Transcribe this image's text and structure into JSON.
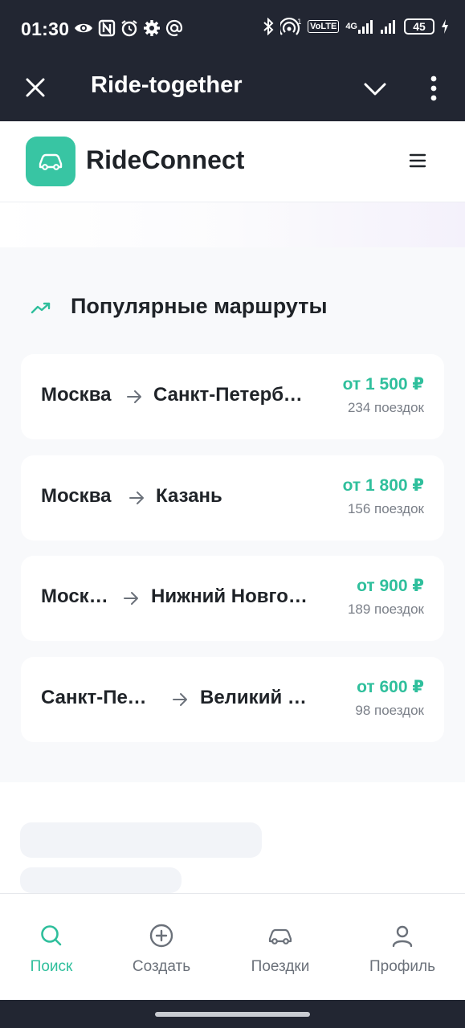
{
  "status_bar": {
    "time": "01:30",
    "volte": "VoLTE",
    "network": "4G",
    "battery": "45",
    "icons": [
      "eye-icon",
      "nfc-icon",
      "alarm-icon",
      "settings-icon",
      "at-icon",
      "bluetooth-icon",
      "hotspot-icon",
      "signal-icon",
      "battery-icon",
      "charging-icon"
    ]
  },
  "app_bar": {
    "title": "Ride-together",
    "icons": [
      "close-icon",
      "chevron-down-icon",
      "more-vert-icon"
    ]
  },
  "header": {
    "brand": "RideConnect",
    "icons": [
      "car-icon",
      "menu-icon"
    ],
    "accent": "#38c5a3"
  },
  "popular": {
    "title": "Популярные маршруты",
    "icon": "trending-up-icon",
    "routes": [
      {
        "from": "Москва",
        "to": "Санкт-Петербург",
        "price": "от 1 500 ₽",
        "trips": "234 поездок"
      },
      {
        "from": "Москва",
        "to": "Казань",
        "price": "от 1 800 ₽",
        "trips": "156 поездок"
      },
      {
        "from": "Москва",
        "to": "Нижний Новгород",
        "price": "от 900 ₽",
        "trips": "189 поездок"
      },
      {
        "from": "Санкт-Петербург",
        "to": "Великий Новгород",
        "price": "от 600 ₽",
        "trips": "98 поездок"
      }
    ]
  },
  "bottom_nav": {
    "items": [
      {
        "label": "Поиск",
        "icon": "search-icon",
        "active": true
      },
      {
        "label": "Создать",
        "icon": "add-circle-icon",
        "active": false
      },
      {
        "label": "Поездки",
        "icon": "car-icon",
        "active": false
      },
      {
        "label": "Профиль",
        "icon": "user-icon",
        "active": false
      }
    ]
  },
  "colors": {
    "accent": "#2fbf9c",
    "dark": "#222632",
    "muted": "#7a7f88"
  }
}
